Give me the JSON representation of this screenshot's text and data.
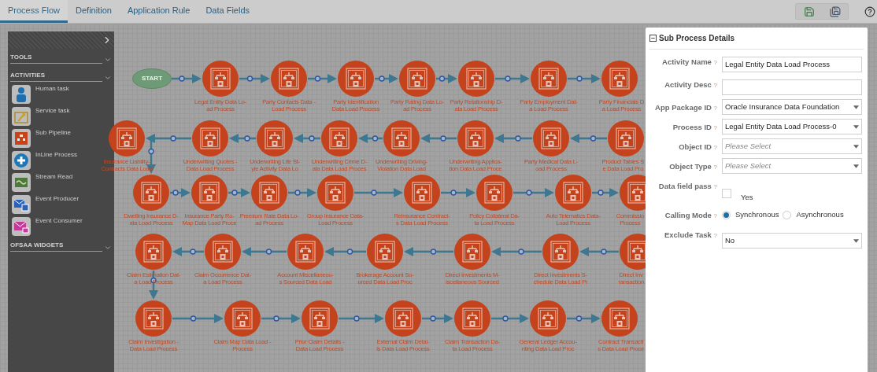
{
  "tabs": [
    {
      "label": "Process Flow",
      "selected": true
    },
    {
      "label": "Definition",
      "selected": false
    },
    {
      "label": "Application Rule",
      "selected": false
    },
    {
      "label": "Data Fields",
      "selected": false
    }
  ],
  "palette": {
    "sections": [
      {
        "title": "TOOLS"
      },
      {
        "title": "ACTIVITIES",
        "items": [
          {
            "kind": "human",
            "label": "Human task"
          },
          {
            "kind": "service",
            "label": "Service task"
          },
          {
            "kind": "pipeline",
            "label": "Sub Pipeline"
          },
          {
            "kind": "inline",
            "label": "InLine Process"
          },
          {
            "kind": "stream",
            "label": "Stream Read"
          },
          {
            "kind": "producer",
            "label": "Event Producer"
          },
          {
            "kind": "consumer",
            "label": "Event Consumer"
          }
        ]
      },
      {
        "title": "OFSAA WIDGETS"
      }
    ]
  },
  "canvas": {
    "start": {
      "label": "START"
    },
    "rows": [
      {
        "nodes": [
          {
            "lines": [
              "Legal Entity Data Lo-",
              "ad Process"
            ]
          },
          {
            "lines": [
              "Party Contacts Data -",
              "Load Process"
            ]
          },
          {
            "lines": [
              "Party Identification",
              "Data Load Process"
            ]
          },
          {
            "lines": [
              "Party Rating Data Lo-",
              "ad Process"
            ]
          },
          {
            "lines": [
              "Party Relationship D-",
              "ata Load Process"
            ]
          },
          {
            "lines": [
              "Party Employment Dat-",
              "a Load Process"
            ]
          },
          {
            "lines": [
              "Party Financials D",
              "a Load Process"
            ]
          }
        ]
      },
      {
        "nodes": [
          {
            "lines": [
              "Insurance Liability-",
              "Contracts Data Load"
            ]
          },
          {
            "lines": [
              "Underwriting Quotes -",
              "Data Load Process"
            ]
          },
          {
            "lines": [
              "Underwriting Life St-",
              "yle Activity Data Lo"
            ]
          },
          {
            "lines": [
              "Underwriting Crime D-",
              "ata Data Load Proces"
            ]
          },
          {
            "lines": [
              "Underwriting Driving-",
              "Violation Data Load"
            ]
          },
          {
            "lines": [
              "Underwriting Applica-",
              "tion Data Load Proce"
            ]
          },
          {
            "lines": [
              "Party Medical Data L-",
              "oad Process"
            ]
          },
          {
            "lines": [
              "Product Tables S",
              "e Data Load Pro"
            ]
          }
        ]
      },
      {
        "nodes": [
          {
            "lines": [
              "Dwelling Insurance D-",
              "ata Load Process"
            ]
          },
          {
            "lines": [
              "Insurance Party Ro-",
              "Map Data Load Proce"
            ]
          },
          {
            "lines": [
              "Premium Rate Data Lo-",
              "ad Process"
            ]
          },
          {
            "lines": [
              "Group Insurance Data-",
              "Load Process"
            ]
          },
          {
            "lines": [
              "Reinsurance Contract-",
              "s Data Load Process"
            ]
          },
          {
            "lines": [
              "Policy Collateral Da-",
              "ta Load Process"
            ]
          },
          {
            "lines": [
              "Auto Telematics Data-",
              "Load Process"
            ]
          },
          {
            "lines": [
              "Commissio",
              "Process"
            ]
          }
        ]
      },
      {
        "nodes": [
          {
            "lines": [
              "Claim Estimation Dat-",
              "a Load Process"
            ]
          },
          {
            "lines": [
              "Claim Occurrence Dat-",
              "a Load Process"
            ]
          },
          {
            "lines": [
              "Account Miscellaneou-",
              "s Sourced Data Load"
            ]
          },
          {
            "lines": [
              "Brokerage Account So-",
              "urced Data Load Proc"
            ]
          },
          {
            "lines": [
              "Direct Investments M-",
              "iscellaneous Sourced"
            ]
          },
          {
            "lines": [
              "Direct Investments S-",
              "chedule Data Load Pr"
            ]
          },
          {
            "lines": [
              "Direct Inv",
              "ransaction"
            ]
          }
        ]
      },
      {
        "nodes": [
          {
            "lines": [
              "Claim Investigation -",
              "Data Load Process"
            ]
          },
          {
            "lines": [
              "Claim Map Data Load -",
              "Process"
            ]
          },
          {
            "lines": [
              "Prior Claim Details -",
              "Data Load Process"
            ]
          },
          {
            "lines": [
              "External Claim Detai-",
              "ls Data Load Process"
            ]
          },
          {
            "lines": [
              "Claim Transaction Da-",
              "ta Load Process"
            ]
          },
          {
            "lines": [
              "General Ledger Accou-",
              "nting Data Load Proc"
            ]
          },
          {
            "lines": [
              "Contract Transacti",
              "s Data Load Proce"
            ]
          }
        ]
      }
    ]
  },
  "panel": {
    "title": "Sub Process Details",
    "fields": [
      {
        "kind": "text",
        "label": "Activity Name",
        "hint": "?",
        "value": "Legal Entity Data Load Process"
      },
      {
        "kind": "text",
        "label": "Activity Desc",
        "hint": "?"
      },
      {
        "kind": "select",
        "label": "App Package ID",
        "hint": "?",
        "value": "Oracle Insurance Data Foundation"
      },
      {
        "kind": "select",
        "label": "Process ID",
        "hint": "?",
        "value": "Legal Entity Data Load Process-0"
      },
      {
        "kind": "select",
        "label": "Object ID",
        "hint": "?",
        "placeholder": "Please Select"
      },
      {
        "kind": "select",
        "label": "Object Type",
        "hint": "?",
        "placeholder": "Please Select"
      },
      {
        "kind": "checkbox",
        "label": "Data field pass",
        "hint": "?",
        "checked": false,
        "option": "Yes"
      },
      {
        "kind": "radio",
        "label": "Calling Mode",
        "hint": "?",
        "options": [
          {
            "label": "Synchronous",
            "selected": true
          },
          {
            "label": "Asynchronous",
            "selected": false
          }
        ]
      },
      {
        "kind": "select",
        "label": "Exclude Task",
        "hint": "?",
        "value": "No"
      }
    ]
  }
}
